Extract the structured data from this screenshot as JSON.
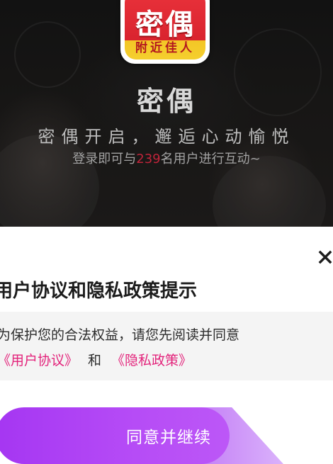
{
  "splash": {
    "logo": {
      "word": "密偶",
      "tag": "附近佳人",
      "colors": {
        "top": "#e9323b",
        "bottom": "#f5cf2e"
      }
    },
    "app_name": "密偶",
    "slogan": "密偶开启，邂逅心动愉悦",
    "login_prefix": "登录即可与",
    "user_count": "239",
    "login_suffix": "名用户进行互动~"
  },
  "dialog": {
    "close_icon": "close-icon",
    "title": "用户协议和隐私政策提示",
    "notice": "为保护您的合法权益，请您先阅读并同意",
    "user_agreement_link": "《用户协议》",
    "and_text": "和",
    "privacy_policy_link": "《隐私政策》",
    "agree_button": "同意并继续"
  },
  "colors": {
    "accent_link": "#e3237b",
    "button_purple": "#b64cf6",
    "count_red": "#c0243a"
  }
}
